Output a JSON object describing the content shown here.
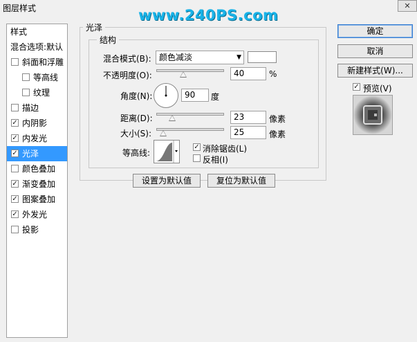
{
  "window": {
    "title": "图层样式",
    "close_symbol": "✕"
  },
  "watermark": "www.240PS.com",
  "sidebar": {
    "header": "样式",
    "blend_options": "混合选项:默认",
    "items": [
      {
        "label": "斜面和浮雕",
        "checked": false
      },
      {
        "label": "等高线",
        "checked": false
      },
      {
        "label": "纹理",
        "checked": false
      },
      {
        "label": "描边",
        "checked": false
      },
      {
        "label": "内阴影",
        "checked": true
      },
      {
        "label": "内发光",
        "checked": true
      },
      {
        "label": "光泽",
        "checked": true,
        "selected": true
      },
      {
        "label": "颜色叠加",
        "checked": false
      },
      {
        "label": "渐变叠加",
        "checked": true
      },
      {
        "label": "图案叠加",
        "checked": true
      },
      {
        "label": "外发光",
        "checked": true
      },
      {
        "label": "投影",
        "checked": false
      }
    ]
  },
  "satin": {
    "group_title": "光泽",
    "structure_title": "结构",
    "blend_mode_label": "混合模式(B):",
    "blend_mode_value": "颜色减淡",
    "opacity_label": "不透明度(O):",
    "opacity_value": "40",
    "opacity_unit": "%",
    "opacity_fraction": 0.4,
    "angle_label": "角度(N):",
    "angle_value": "90",
    "angle_unit": "度",
    "distance_label": "距离(D):",
    "distance_value": "23",
    "distance_unit": "像素",
    "distance_fraction": 0.23,
    "size_label": "大小(S):",
    "size_value": "25",
    "size_unit": "像素",
    "size_fraction": 0.1,
    "contour_label": "等高线:",
    "anti_alias_label": "消除锯齿(L)",
    "anti_alias_checked": true,
    "invert_label": "反相(I)",
    "invert_checked": false,
    "make_default": "设置为默认值",
    "reset_default": "复位为默认值"
  },
  "buttons": {
    "ok": "确定",
    "cancel": "取消",
    "new_style": "新建样式(W)...",
    "preview_label": "预览(V)",
    "preview_checked": true
  },
  "colors": {
    "selection": "#3399ff",
    "watermark": "#19b3e8"
  }
}
